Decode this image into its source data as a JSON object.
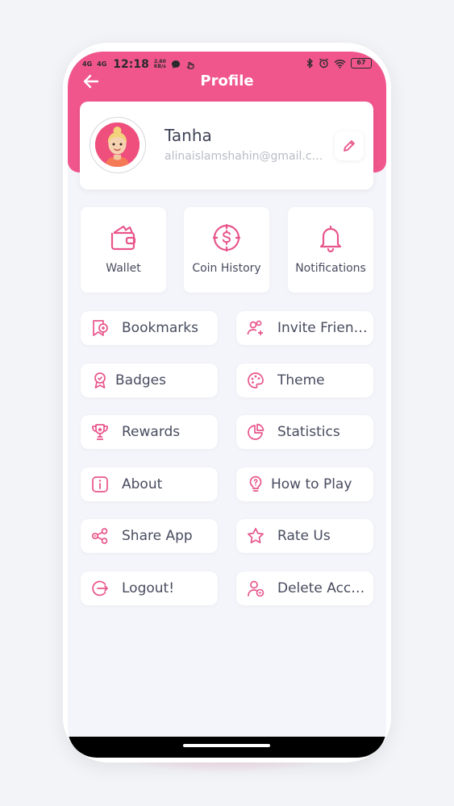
{
  "status_bar": {
    "signal_1": "4G",
    "signal_2": "4G",
    "time": "12:18",
    "speed_value": "2.60",
    "speed_unit": "KB/s",
    "battery": "67"
  },
  "header": {
    "title": "Profile"
  },
  "profile": {
    "name": "Tanha",
    "email": "alinaislamshahin@gmail.com"
  },
  "tiles": [
    {
      "label": "Wallet",
      "icon": "wallet-icon"
    },
    {
      "label": "Coin History",
      "icon": "coin-icon"
    },
    {
      "label": "Notifications",
      "icon": "bell-icon"
    }
  ],
  "menu": [
    {
      "label": "Bookmarks",
      "icon": "bookmark-icon"
    },
    {
      "label": "Invite Friends",
      "icon": "invite-friends-icon"
    },
    {
      "label": "Badges",
      "icon": "badge-icon"
    },
    {
      "label": "Theme",
      "icon": "palette-icon"
    },
    {
      "label": "Rewards",
      "icon": "trophy-icon"
    },
    {
      "label": "Statistics",
      "icon": "pie-chart-icon"
    },
    {
      "label": "About",
      "icon": "info-icon"
    },
    {
      "label": "How to Play",
      "icon": "lightbulb-icon"
    },
    {
      "label": "Share App",
      "icon": "share-icon"
    },
    {
      "label": "Rate Us",
      "icon": "star-icon"
    },
    {
      "label": "Logout!",
      "icon": "logout-icon"
    },
    {
      "label": "Delete Account",
      "icon": "delete-account-icon"
    }
  ],
  "colors": {
    "accent": "#f0568c",
    "background": "#f4f5fb",
    "text": "#474b5e"
  }
}
